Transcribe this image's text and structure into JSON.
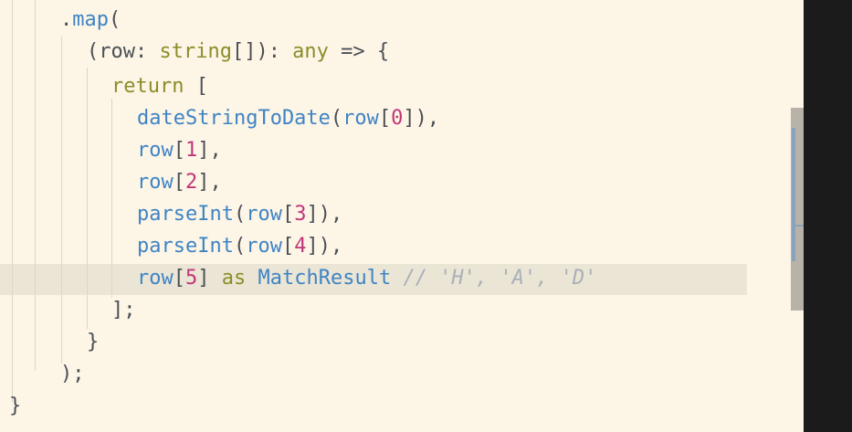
{
  "editor": {
    "lines": [
      {
        "tokens": [
          {
            "text": ".",
            "cls": "pun"
          },
          {
            "text": "map",
            "cls": "fn"
          },
          {
            "text": "(",
            "cls": "pun"
          }
        ]
      },
      {
        "tokens": [
          {
            "text": "(row",
            "cls": "pun"
          },
          {
            "text": ":",
            "cls": "pun"
          },
          {
            "text": " string",
            "cls": "kw"
          },
          {
            "text": "[]):",
            "cls": "pun"
          },
          {
            "text": " any",
            "cls": "kw"
          },
          {
            "text": " => {",
            "cls": "pun"
          }
        ]
      },
      {
        "tokens": [
          {
            "text": "return",
            "cls": "kw"
          },
          {
            "text": " [",
            "cls": "pun"
          }
        ]
      },
      {
        "tokens": [
          {
            "text": "dateStringToDate",
            "cls": "fn"
          },
          {
            "text": "(",
            "cls": "pun"
          },
          {
            "text": "row",
            "cls": "fn"
          },
          {
            "text": "[",
            "cls": "pun"
          },
          {
            "text": "0",
            "cls": "num"
          },
          {
            "text": "]),",
            "cls": "pun"
          }
        ]
      },
      {
        "tokens": [
          {
            "text": "row",
            "cls": "fn"
          },
          {
            "text": "[",
            "cls": "pun"
          },
          {
            "text": "1",
            "cls": "num"
          },
          {
            "text": "],",
            "cls": "pun"
          }
        ]
      },
      {
        "tokens": [
          {
            "text": "row",
            "cls": "fn"
          },
          {
            "text": "[",
            "cls": "pun"
          },
          {
            "text": "2",
            "cls": "num"
          },
          {
            "text": "],",
            "cls": "pun"
          }
        ]
      },
      {
        "tokens": [
          {
            "text": "parseInt",
            "cls": "fn"
          },
          {
            "text": "(",
            "cls": "pun"
          },
          {
            "text": "row",
            "cls": "fn"
          },
          {
            "text": "[",
            "cls": "pun"
          },
          {
            "text": "3",
            "cls": "num"
          },
          {
            "text": "]),",
            "cls": "pun"
          }
        ]
      },
      {
        "tokens": [
          {
            "text": "parseInt",
            "cls": "fn"
          },
          {
            "text": "(",
            "cls": "pun"
          },
          {
            "text": "row",
            "cls": "fn"
          },
          {
            "text": "[",
            "cls": "pun"
          },
          {
            "text": "4",
            "cls": "num"
          },
          {
            "text": "]),",
            "cls": "pun"
          }
        ]
      },
      {
        "tokens": [
          {
            "text": "row",
            "cls": "fn"
          },
          {
            "text": "[",
            "cls": "pun"
          },
          {
            "text": "5",
            "cls": "num"
          },
          {
            "text": "]",
            "cls": "pun"
          },
          {
            "text": " as",
            "cls": "kw"
          },
          {
            "text": " MatchResult",
            "cls": "fn"
          },
          {
            "text": " // 'H', 'A', 'D'",
            "cls": "cm"
          }
        ]
      },
      {
        "tokens": [
          {
            "text": "];",
            "cls": "pun"
          }
        ]
      },
      {
        "tokens": [
          {
            "text": "}",
            "cls": "pun"
          }
        ]
      },
      {
        "tokens": [
          {
            "text": ");",
            "cls": "pun"
          }
        ]
      },
      {
        "tokens": [
          {
            "text": "}",
            "cls": "pun"
          }
        ]
      }
    ]
  },
  "colors": {
    "background": "#fdf5e6",
    "function": "#3f84c4",
    "keyword": "#8a8e2a",
    "number": "#c2367a",
    "comment": "#a8b0b8",
    "line_highlight": "#ebe5d5"
  }
}
